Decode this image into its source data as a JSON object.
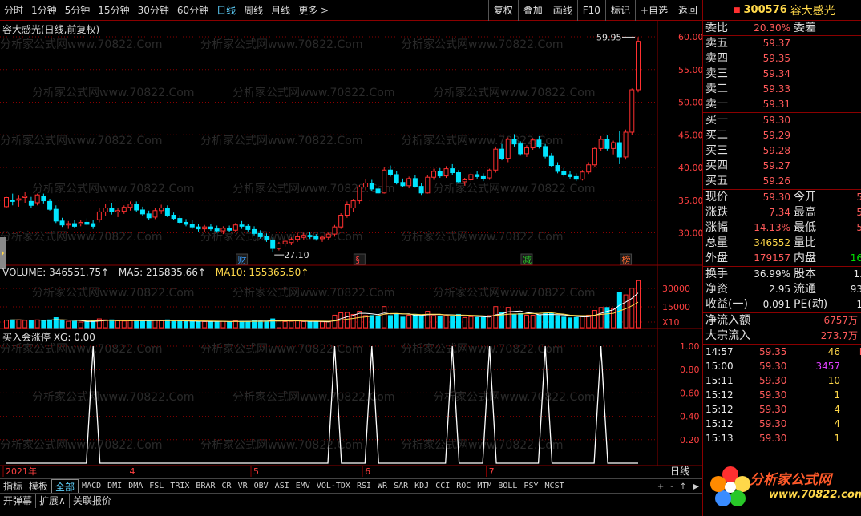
{
  "periods": [
    "分时",
    "1分钟",
    "5分钟",
    "15分钟",
    "30分钟",
    "60分钟",
    "日线",
    "周线",
    "月线",
    "更多 >"
  ],
  "active_period": "日线",
  "tools": [
    "复权",
    "叠加",
    "画线",
    "F10",
    "标记",
    "+自选",
    "返回"
  ],
  "chart": {
    "title": "容大感光(日线,前复权)",
    "price_axis": [
      "60.00",
      "55.00",
      "50.00",
      "45.00",
      "40.00",
      "35.00",
      "30.00"
    ],
    "high_label": "59.95",
    "low_label": "27.10",
    "event_tags": [
      {
        "text": "财",
        "color": "#3aa0ff"
      },
      {
        "text": "§",
        "color": "#ff4040"
      },
      {
        "text": "减",
        "color": "#28c828"
      },
      {
        "text": "榜",
        "color": "#ff6a30"
      }
    ],
    "volume_line": {
      "volume": "VOLUME: 346551.75↑",
      "ma5": "MA5: 215835.66↑",
      "ma10": "MA10: 155365.50↑"
    },
    "volume_axis": [
      "30000",
      "15000",
      "X10"
    ],
    "indicator_title": "买入会涨停 XG: 0.00",
    "indicator_axis": [
      "1.00",
      "0.80",
      "0.60",
      "0.40",
      "0.20"
    ],
    "months": [
      "2021年",
      "4",
      "5",
      "6",
      "7"
    ],
    "period_tag": "日线",
    "watermark": "分析家公式网www.70822.Com"
  },
  "tabs_row1": [
    "指标",
    "模板",
    "全部",
    "MACD",
    "DMI",
    "DMA",
    "FSL",
    "TRIX",
    "BRAR",
    "CR",
    "VR",
    "OBV",
    "ASI",
    "EMV",
    "VOL-TDX",
    "RSI",
    "WR",
    "SAR",
    "KDJ",
    "CCI",
    "ROC",
    "MTM",
    "BOLL",
    "PSY",
    "MCST"
  ],
  "active_tab": "全部",
  "tabs_row2": [
    "开弹幕",
    "扩展∧",
    "关联报价"
  ],
  "scroll_btns": [
    "+",
    "-",
    "↑",
    "▶"
  ],
  "quote": {
    "code": "300576",
    "name": "容大感光",
    "weibi": {
      "label": "委比",
      "value": "20.30%",
      "label2": "委差"
    },
    "sells": [
      {
        "label": "卖五",
        "price": "59.37"
      },
      {
        "label": "卖四",
        "price": "59.35"
      },
      {
        "label": "卖三",
        "price": "59.34"
      },
      {
        "label": "卖二",
        "price": "59.33"
      },
      {
        "label": "卖一",
        "price": "59.31"
      }
    ],
    "buys": [
      {
        "label": "买一",
        "price": "59.30"
      },
      {
        "label": "买二",
        "price": "59.29"
      },
      {
        "label": "买三",
        "price": "59.28"
      },
      {
        "label": "买四",
        "price": "59.27"
      },
      {
        "label": "买五",
        "price": "59.26"
      }
    ],
    "stats": [
      {
        "l1": "现价",
        "v1": "59.30",
        "c1": "red",
        "l2": "今开",
        "v2": "5",
        "c2": "red"
      },
      {
        "l1": "涨跌",
        "v1": "7.34",
        "c1": "red",
        "l2": "最高",
        "v2": "5",
        "c2": "red"
      },
      {
        "l1": "涨幅",
        "v1": "14.13%",
        "c1": "red",
        "l2": "最低",
        "v2": "5",
        "c2": "red"
      },
      {
        "l1": "总量",
        "v1": "346552",
        "c1": "yellow",
        "l2": "量比",
        "v2": "",
        "c2": "white"
      },
      {
        "l1": "外盘",
        "v1": "179157",
        "c1": "red",
        "l2": "内盘",
        "v2": "16",
        "c2": "green"
      }
    ],
    "fin": [
      {
        "l1": "换手",
        "v1": "36.99%",
        "l2": "股本",
        "v2": "1."
      },
      {
        "l1": "净资",
        "v1": "2.95",
        "l2": "流通",
        "v2": "93"
      },
      {
        "l1": "收益(一)",
        "v1": "0.091",
        "l2": "PE(动)",
        "v2": "1"
      }
    ],
    "flows": [
      {
        "label": "净流入额",
        "value": "6757万"
      },
      {
        "label": "大宗流入",
        "value": "273.7万"
      }
    ],
    "ticks": [
      {
        "time": "14:57",
        "price": "59.35",
        "vol": "46",
        "color": "yellow",
        "flag": "B"
      },
      {
        "time": "15:00",
        "price": "59.30",
        "vol": "3457",
        "color": "purple",
        "flag": ""
      },
      {
        "time": "15:11",
        "price": "59.30",
        "vol": "10",
        "color": "yellow",
        "flag": ""
      },
      {
        "time": "15:12",
        "price": "59.30",
        "vol": "1",
        "color": "yellow",
        "flag": ""
      },
      {
        "time": "15:12",
        "price": "59.30",
        "vol": "4",
        "color": "yellow",
        "flag": ""
      },
      {
        "time": "15:12",
        "price": "59.30",
        "vol": "4",
        "color": "yellow",
        "flag": ""
      },
      {
        "time": "15:13",
        "price": "59.30",
        "vol": "1",
        "color": "yellow",
        "flag": ""
      }
    ]
  },
  "logo": {
    "text": "分析家公式网",
    "url": "www.70822.com"
  },
  "colors": {
    "up": "#ff3030",
    "down": "#00e5ff",
    "ma5": "#ffffff",
    "ma10": "#ffd84a",
    "grid": "#8b0000"
  }
}
